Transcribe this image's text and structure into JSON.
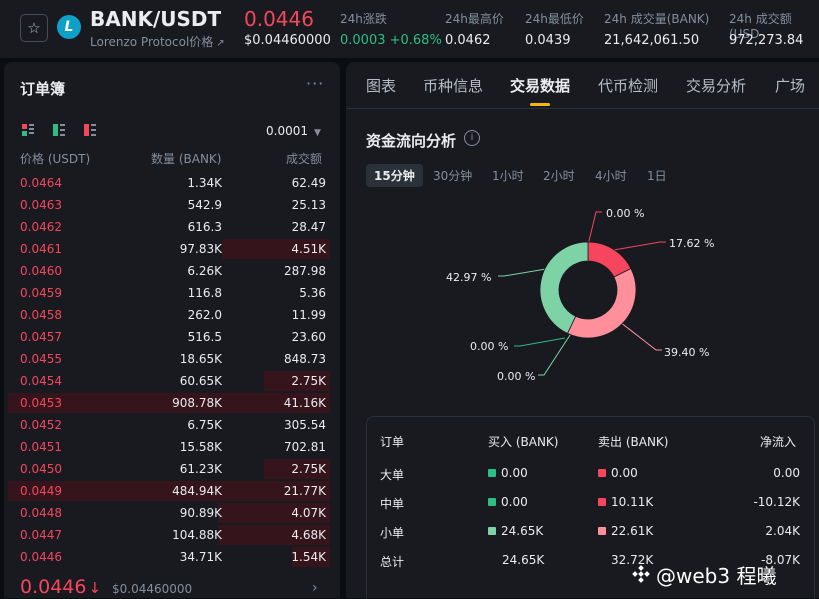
{
  "header": {
    "star_icon": "star-icon",
    "coin_logo_letter": "L",
    "pair": "BANK/USDT",
    "sub_name": "Lorenzo Protocol价格",
    "sub_name_arrow": "↗",
    "price": "0.0446",
    "price_usd": "$0.04460000",
    "stats": [
      {
        "label": "24h涨跌",
        "value": "0.0003 +0.68%",
        "color": "#2ebd85"
      },
      {
        "label": "24h最高价",
        "value": "0.0462"
      },
      {
        "label": "24h最低价",
        "value": "0.0439"
      },
      {
        "label": "24h 成交量(BANK)",
        "value": "21,642,061.50"
      },
      {
        "label": "24h 成交额(USD",
        "value": "972,273.84"
      }
    ]
  },
  "orderbook": {
    "title": "订单簿",
    "more": "···",
    "tick_size": "0.0001",
    "col_price": "价格 (USDT)",
    "col_qty": "数量 (BANK)",
    "col_total": "成交额",
    "rows": [
      {
        "price": "0.0464",
        "qty": "1.34K",
        "total": "62.49",
        "depth": 0
      },
      {
        "price": "0.0463",
        "qty": "542.9",
        "total": "25.13",
        "depth": 0
      },
      {
        "price": "0.0462",
        "qty": "616.3",
        "total": "28.47",
        "depth": 0
      },
      {
        "price": "0.0461",
        "qty": "97.83K",
        "total": "4.51K",
        "depth": 0.31
      },
      {
        "price": "0.0460",
        "qty": "6.26K",
        "total": "287.98",
        "depth": 0
      },
      {
        "price": "0.0459",
        "qty": "116.8",
        "total": "5.36",
        "depth": 0
      },
      {
        "price": "0.0458",
        "qty": "262.0",
        "total": "11.99",
        "depth": 0
      },
      {
        "price": "0.0457",
        "qty": "516.5",
        "total": "23.60",
        "depth": 0
      },
      {
        "price": "0.0455",
        "qty": "18.65K",
        "total": "848.73",
        "depth": 0
      },
      {
        "price": "0.0454",
        "qty": "60.65K",
        "total": "2.75K",
        "depth": 0.19
      },
      {
        "price": "0.0453",
        "qty": "908.78K",
        "total": "41.16K",
        "depth": 1.0
      },
      {
        "price": "0.0452",
        "qty": "6.75K",
        "total": "305.54",
        "depth": 0
      },
      {
        "price": "0.0451",
        "qty": "15.58K",
        "total": "702.81",
        "depth": 0
      },
      {
        "price": "0.0450",
        "qty": "61.23K",
        "total": "2.75K",
        "depth": 0.19
      },
      {
        "price": "0.0449",
        "qty": "484.94K",
        "total": "21.77K",
        "depth": 1.0
      },
      {
        "price": "0.0448",
        "qty": "90.89K",
        "total": "4.07K",
        "depth": 0.32
      },
      {
        "price": "0.0447",
        "qty": "104.88K",
        "total": "4.68K",
        "depth": 0.32
      },
      {
        "price": "0.0446",
        "qty": "34.71K",
        "total": "1.54K",
        "depth": 0.11
      }
    ],
    "last_price": "0.0446",
    "last_arrow": "↓",
    "last_price_usd": "$0.04460000",
    "chevron": "›"
  },
  "tabs": [
    "图表",
    "币种信息",
    "交易数据",
    "代币检测",
    "交易分析",
    "广场"
  ],
  "active_tab": 2,
  "capital_flow": {
    "title": "资金流向分析",
    "info_icon": "i",
    "intervals": [
      "15分钟",
      "30分钟",
      "1小时",
      "2小时",
      "4小时",
      "1日"
    ],
    "active_interval": 0,
    "donut": {
      "slices": [
        {
          "label": "0.00 %",
          "value": 0.0,
          "color": "#0ecb81"
        },
        {
          "label": "17.62 %",
          "value": 17.62,
          "color": "#f6465d"
        },
        {
          "label": "39.40 %",
          "value": 39.4,
          "color": "#ff8f9a"
        },
        {
          "label": "0.00 %",
          "value": 0.0,
          "color": "#2ebd85"
        },
        {
          "label": "0.00 %",
          "value": 0.0,
          "color": "#7dd3a6"
        },
        {
          "label": "42.97 %",
          "value": 42.97,
          "color": "#7dd3a6"
        }
      ]
    },
    "table": {
      "headers": [
        "订单",
        "买入 (BANK)",
        "卖出 (BANK)",
        "净流入"
      ],
      "rows": [
        {
          "name": "大单",
          "buy": "0.00",
          "sell": "0.00",
          "net": "0.00",
          "buy_color": "#2ebd85",
          "sell_color": "#f6465d"
        },
        {
          "name": "中单",
          "buy": "0.00",
          "sell": "10.11K",
          "net": "-10.12K",
          "buy_color": "#2ebd85",
          "sell_color": "#f6465d"
        },
        {
          "name": "小单",
          "buy": "24.65K",
          "sell": "22.61K",
          "net": "2.04K",
          "buy_color": "#7dd3a6",
          "sell_color": "#ff8f9a"
        },
        {
          "name": "总计",
          "buy": "24.65K",
          "sell": "32.72K",
          "net": "-8.07K"
        }
      ]
    }
  },
  "watermark": "@web3  程曦"
}
